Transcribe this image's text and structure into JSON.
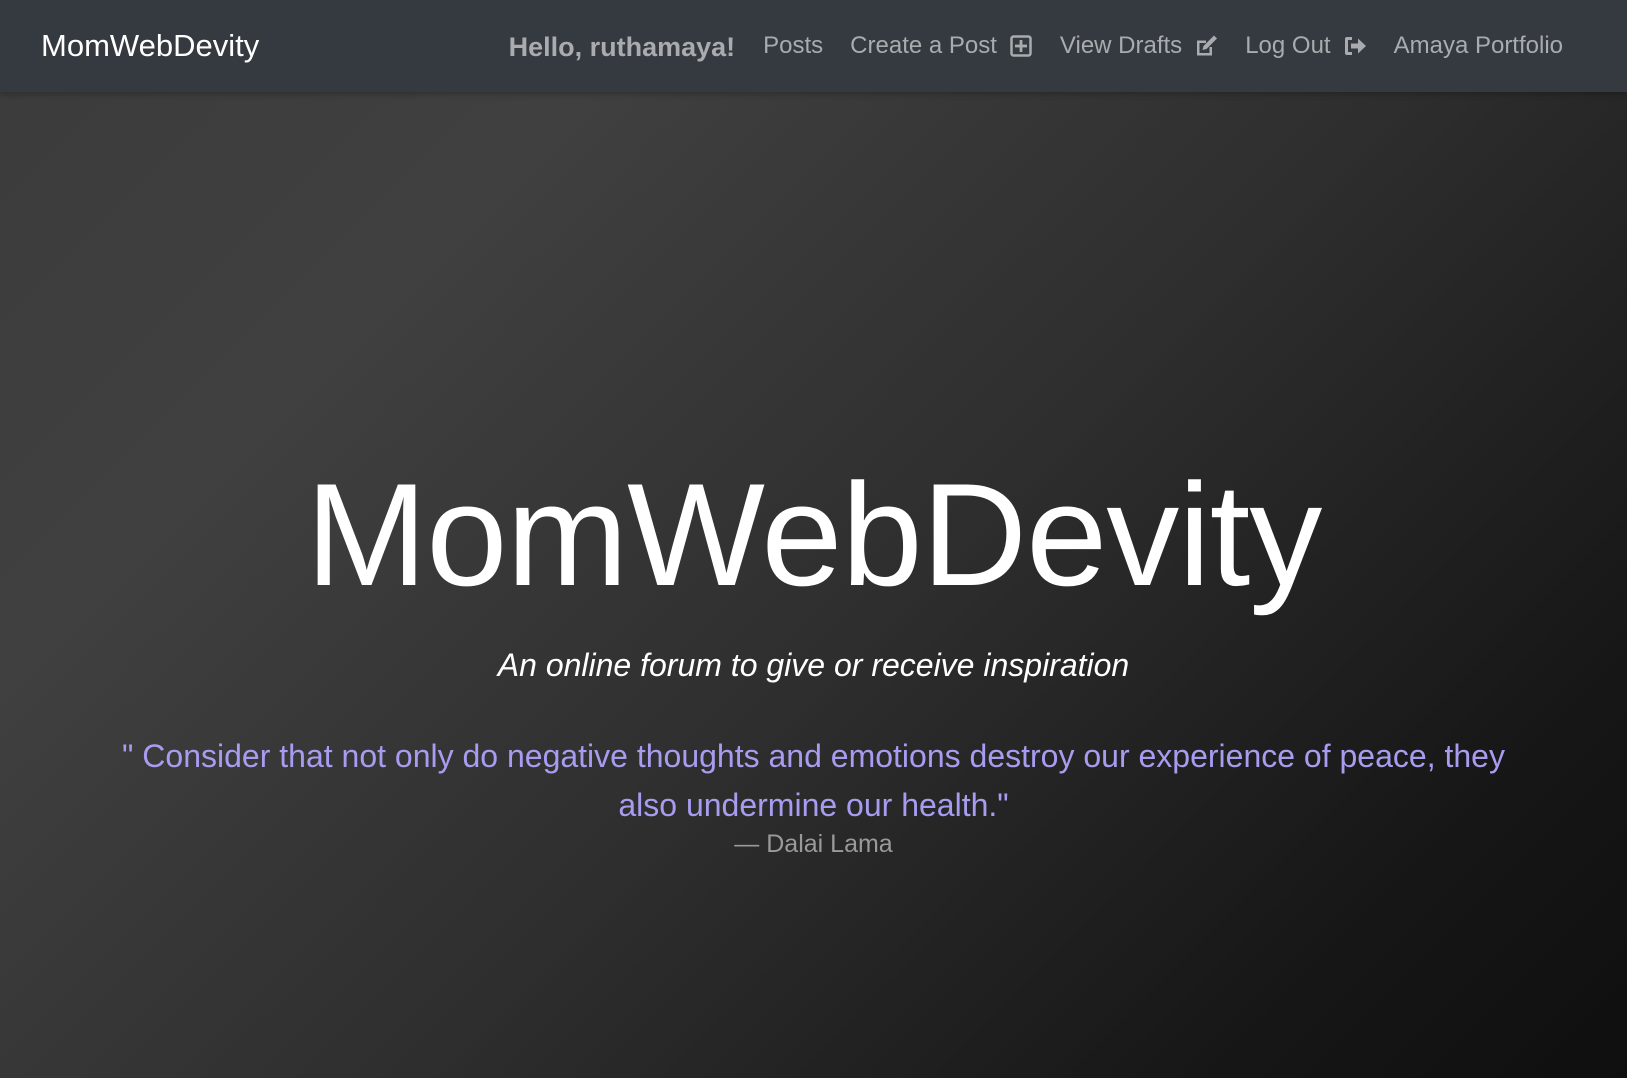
{
  "navbar": {
    "brand": "MomWebDevity",
    "greeting": "Hello, ruthamaya!",
    "links": [
      {
        "label": "Posts",
        "icon": null
      },
      {
        "label": "Create a Post",
        "icon": "plus-square-icon"
      },
      {
        "label": "View Drafts",
        "icon": "edit-icon"
      },
      {
        "label": "Log Out",
        "icon": "sign-out-icon"
      },
      {
        "label": "Amaya Portfolio",
        "icon": null
      }
    ]
  },
  "hero": {
    "title": "MomWebDevity",
    "subtitle": "An online forum to give or receive inspiration",
    "quote": "\" Consider that not only do negative thoughts and emotions destroy our experience of peace, they also undermine our health.\"",
    "quote_author": "— Dalai Lama"
  },
  "colors": {
    "navbar_bg": "#343a40",
    "nav_text": "#a9abae",
    "quote_text": "#a89cf0",
    "author_text": "#9a9a9a"
  }
}
